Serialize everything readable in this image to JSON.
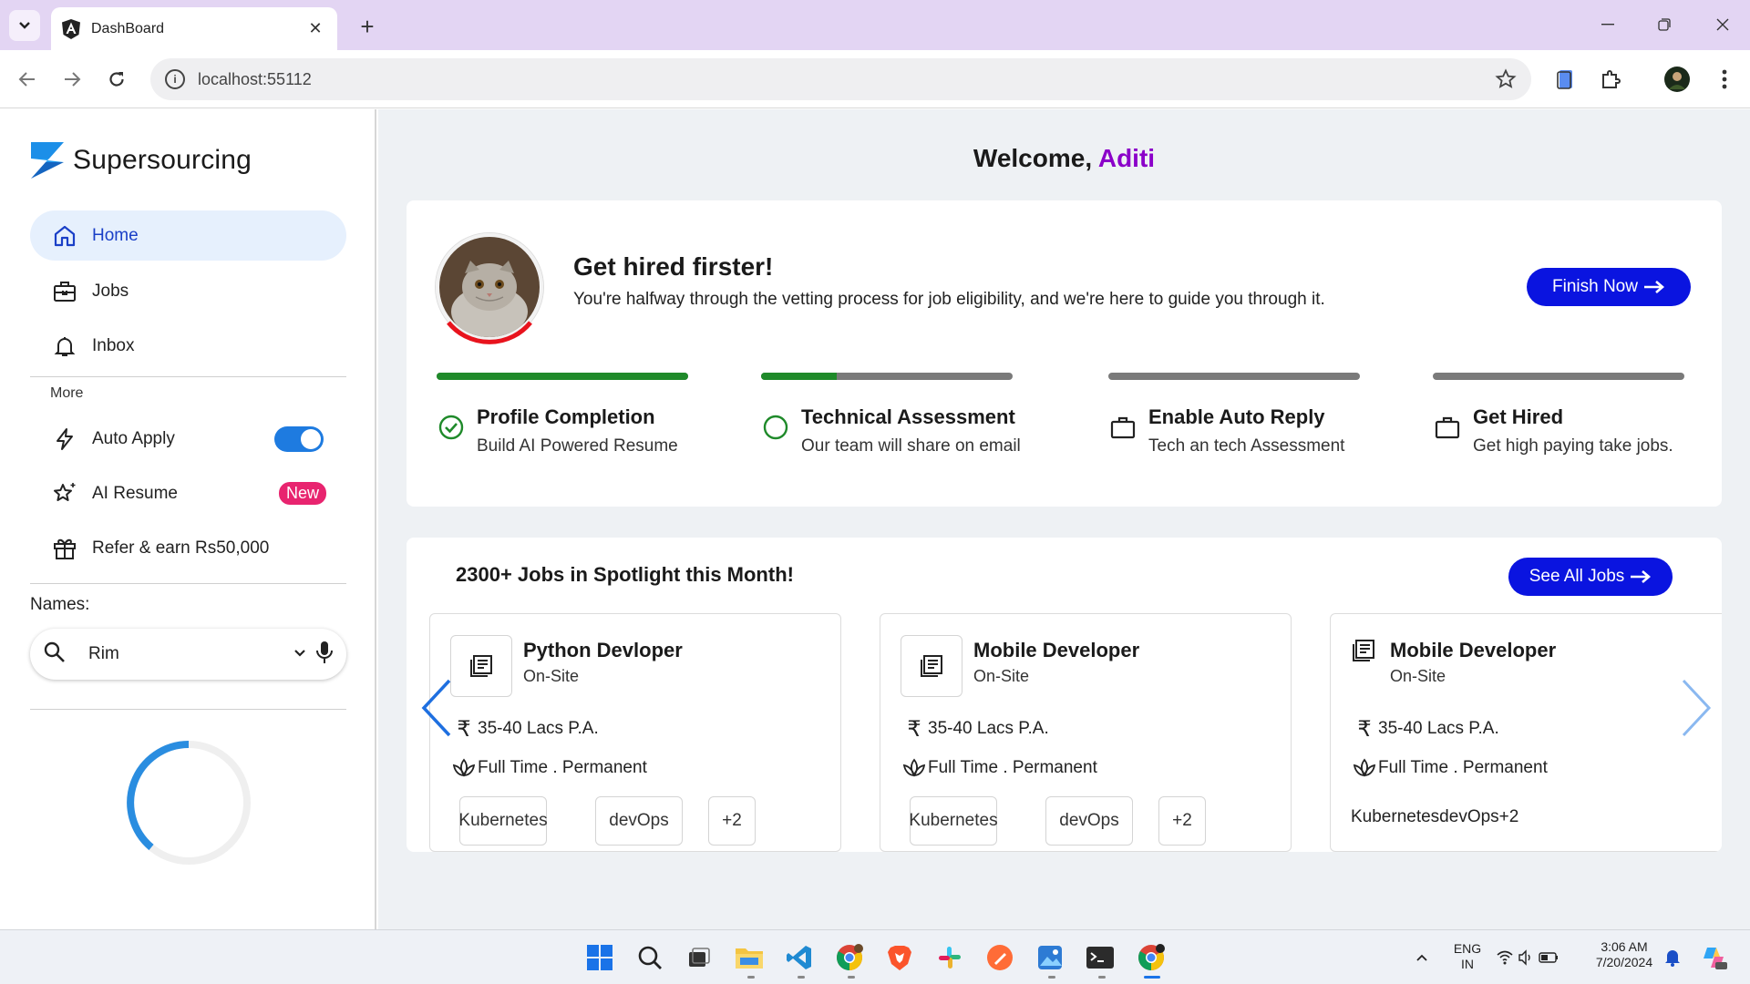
{
  "browser": {
    "tab_title": "DashBoard",
    "url": "localhost:55112"
  },
  "sidebar": {
    "brand": "Supersourcing",
    "nav": [
      {
        "label": "Home",
        "icon": "home-icon",
        "active": true
      },
      {
        "label": "Jobs",
        "icon": "briefcase-icon"
      },
      {
        "label": "Inbox",
        "icon": "bell-icon"
      }
    ],
    "more_label": "More",
    "more_items": [
      {
        "label": "Auto Apply",
        "icon": "lightning-icon",
        "toggle_on": true
      },
      {
        "label": "AI Resume",
        "icon": "sparkle-star-icon",
        "badge": "New"
      },
      {
        "label": "Refer & earn Rs50,000",
        "icon": "gift-icon"
      }
    ],
    "names_label": "Names:",
    "search_value": "Rim"
  },
  "main": {
    "welcome_prefix": "Welcome,",
    "welcome_name": "Aditi",
    "hire": {
      "title": "Get hired firster!",
      "subtitle": "You're halfway through the vetting process for job eligibility, and we're here to guide you through it.",
      "button": "Finish Now"
    },
    "steps": [
      {
        "title": "Profile Completion",
        "desc": "Build AI Powered Resume",
        "progress": 1.0,
        "icon": "check-circle-icon"
      },
      {
        "title": "Technical Assessment",
        "desc": "Our team will share on email",
        "progress": 0.3,
        "icon": "circle-outline-icon"
      },
      {
        "title": "Enable Auto Reply",
        "desc": "Tech an tech Assessment",
        "progress": 0,
        "icon": "briefcase-icon"
      },
      {
        "title": "Get Hired",
        "desc": "Get high paying take jobs.",
        "progress": 0,
        "icon": "briefcase-icon"
      }
    ],
    "jobs": {
      "title": "2300+ Jobs in Spotlight this Month!",
      "button": "See All Jobs",
      "cards": [
        {
          "title": "Python Devloper",
          "type": "On-Site",
          "salary": "35-40 Lacs P.A.",
          "employment": "Full Time . Permanent",
          "chips": [
            "Kubernetes",
            "devOps",
            "+2"
          ]
        },
        {
          "title": "Mobile Developer",
          "type": "On-Site",
          "salary": "35-40 Lacs P.A.",
          "employment": "Full Time . Permanent",
          "chips": [
            "Kubernetes",
            "devOps",
            "+2"
          ]
        },
        {
          "title": "Mobile Developer",
          "type": "On-Site",
          "salary": "35-40 Lacs P.A.",
          "employment": "Full Time . Permanent",
          "chips_inline": "KubernetesdevOps+2"
        }
      ]
    }
  },
  "taskbar": {
    "lang_line1": "ENG",
    "lang_line2": "IN",
    "time": "3:06 AM",
    "date": "7/20/2024"
  },
  "colors": {
    "primary_button": "#0a14e0",
    "welcome_name": "#8b00c9",
    "progress_green": "#1f8a2a",
    "badge_pink": "#e8246f",
    "toggle_blue": "#1e7be0"
  }
}
